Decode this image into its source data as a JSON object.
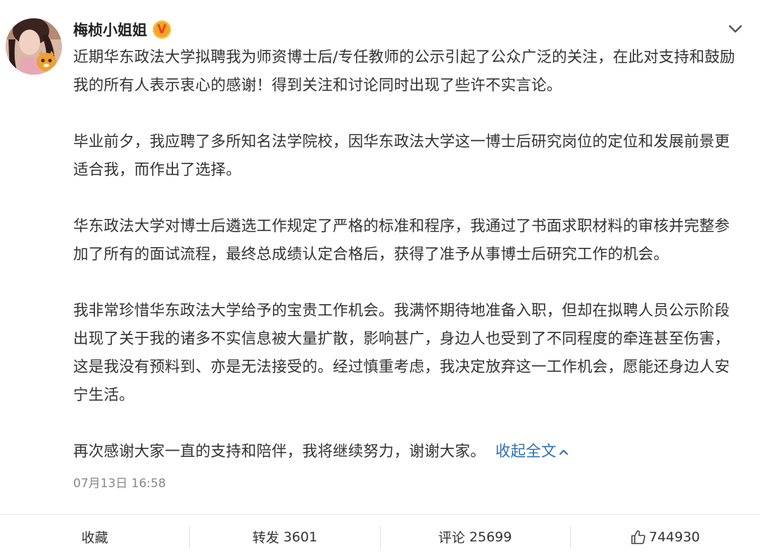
{
  "post": {
    "author": "梅桢小姐姐",
    "verified_badge": "V",
    "paragraphs": [
      "近期华东政法大学拟聘我为师资博士后/专任教师的公示引起了公众广泛的关注，在此对支持和鼓励我的所有人表示衷心的感谢！得到关注和讨论同时出现了些许不实言论。",
      "毕业前夕，我应聘了多所知名法学院校，因华东政法大学这一博士后研究岗位的定位和发展前景更适合我，而作出了选择。",
      "华东政法大学对博士后遴选工作规定了严格的标准和程序，我通过了书面求职材料的审核并完整参加了所有的面试流程，最终总成绩认定合格后，获得了准予从事博士后研究工作的机会。",
      "我非常珍惜华东政法大学给予的宝贵工作机会。我满怀期待地准备入职，但却在拟聘人员公示阶段出现了关于我的诸多不实信息被大量扩散，影响甚广，身边人也受到了不同程度的牵连甚至伤害，这是我没有预料到、亦是无法接受的。经过慎重考虑，我决定放弃这一工作机会，愿能还身边人安宁生活。",
      "再次感谢大家一直的支持和陪伴，我将继续努力，谢谢大家。"
    ],
    "collapse_label": "收起全文",
    "timestamp": "07月13日 16:58"
  },
  "actions": {
    "favorite_label": "收藏",
    "repost_label": "转发",
    "repost_count": "3601",
    "comment_label": "评论",
    "comment_count": "25699",
    "like_count": "744930"
  },
  "icons": {
    "menu": "chevron-down-icon",
    "collapse": "chevron-up-icon",
    "like": "thumbs-up-icon"
  },
  "colors": {
    "link": "#2f6fb5",
    "text": "#333333",
    "meta": "#888888",
    "badge": "#f5a623"
  }
}
